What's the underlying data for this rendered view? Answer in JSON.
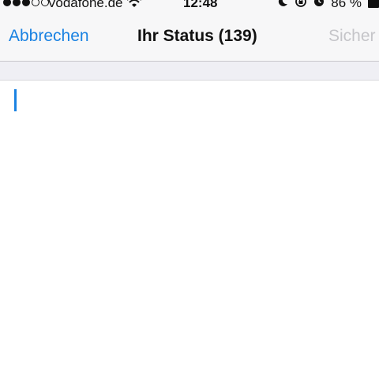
{
  "status_bar": {
    "signal_dots": [
      "full",
      "full",
      "full",
      "empty",
      "empty"
    ],
    "carrier": "Vodafone.de",
    "wifi_icon": "wifi-icon",
    "time": "12:48",
    "icons": [
      "moon-icon",
      "rotation-lock-icon",
      "alarm-icon"
    ],
    "battery_percent": "86 %",
    "battery_icon": "battery-icon"
  },
  "nav_bar": {
    "cancel_label": "Abbrechen",
    "title": "Ihr Status (139)",
    "save_label": "Sicher"
  },
  "editor": {
    "value": "",
    "caret_color": "#1a82e2"
  },
  "colors": {
    "accent": "#1a82e2",
    "disabled": "#c5c5c9",
    "bar_background": "#f7f7f8",
    "group_background": "#efeff4"
  }
}
